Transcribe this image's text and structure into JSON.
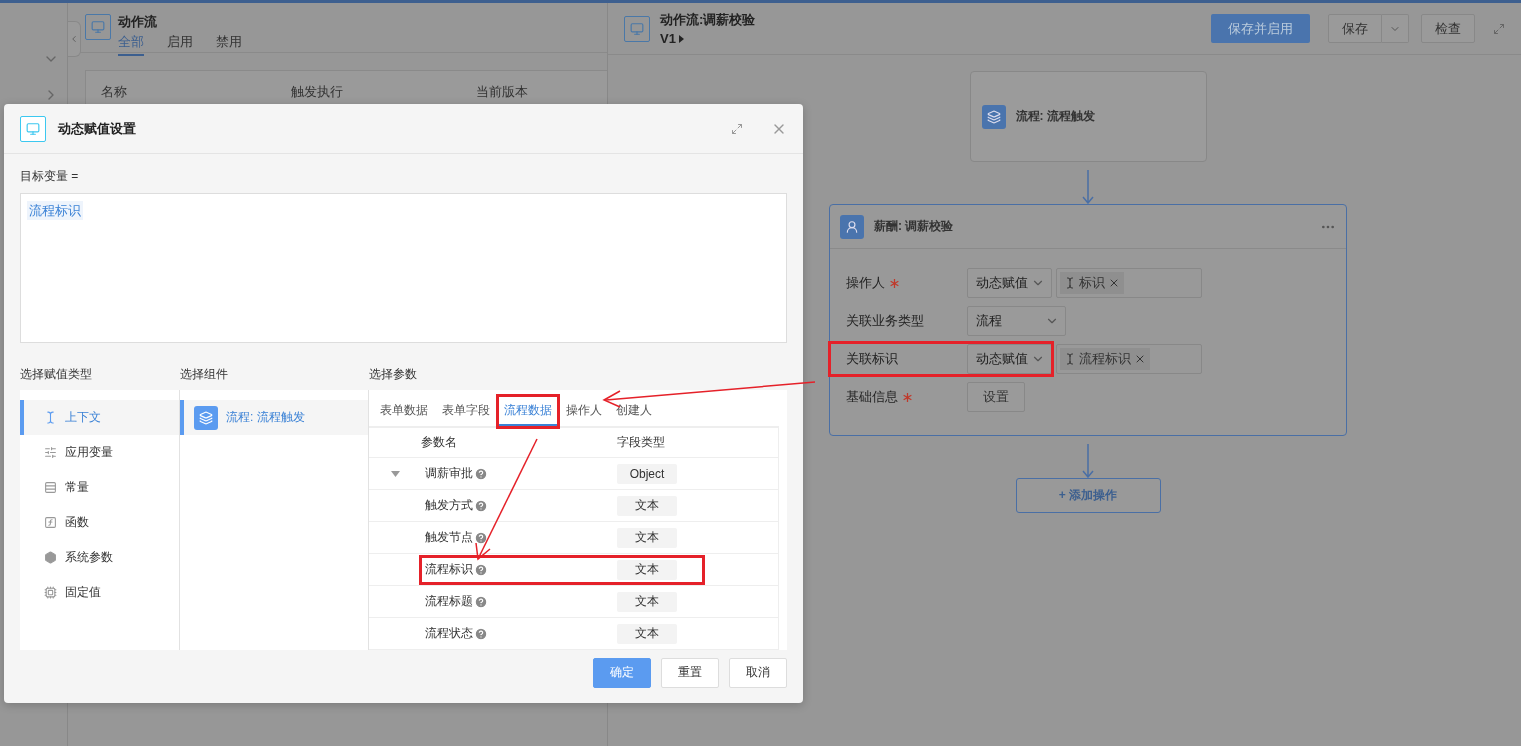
{
  "list_panel": {
    "title": "动作流",
    "tabs": [
      {
        "label": "全部",
        "selected": true
      },
      {
        "label": "启用",
        "selected": false
      },
      {
        "label": "禁用",
        "selected": false
      }
    ],
    "columns": [
      "名称",
      "触发执行",
      "当前版本"
    ]
  },
  "editor": {
    "title": "动作流:调薪校验",
    "version": "V1",
    "save_enable_button": "保存并启用",
    "save_button": "保存",
    "check_button": "检查",
    "trigger_node": {
      "title": "流程: 流程触发"
    },
    "action_node": {
      "title": "薪酬: 调薪校验",
      "fields": [
        {
          "label": "操作人",
          "required": true,
          "kind": "dynamic",
          "mode": "动态赋值",
          "tag": "标识",
          "highlighted": false
        },
        {
          "label": "关联业务类型",
          "required": false,
          "kind": "select",
          "mode": "流程",
          "highlighted": false
        },
        {
          "label": "关联标识",
          "required": false,
          "kind": "dynamic",
          "mode": "动态赋值",
          "tag": "流程标识",
          "highlighted": true
        },
        {
          "label": "基础信息",
          "required": true,
          "kind": "button",
          "button": "设置",
          "highlighted": false
        }
      ]
    },
    "add_button": "+ 添加操作"
  },
  "dialog": {
    "title": "动态赋值设置",
    "target_label": "目标变量 =",
    "target_value": "流程标识",
    "type_section": {
      "heading": "选择赋值类型",
      "items": [
        {
          "label": "上下文",
          "kind": "context",
          "selected": true
        },
        {
          "label": "应用变量",
          "kind": "variable",
          "selected": false
        },
        {
          "label": "常量",
          "kind": "constant",
          "selected": false
        },
        {
          "label": "函数",
          "kind": "function",
          "selected": false
        },
        {
          "label": "系统参数",
          "kind": "system",
          "selected": false
        },
        {
          "label": "固定值",
          "kind": "fixed",
          "selected": false
        }
      ]
    },
    "component_section": {
      "heading": "选择组件",
      "items": [
        {
          "label": "流程: 流程触发",
          "selected": true
        }
      ]
    },
    "param_section": {
      "heading": "选择参数",
      "tabs": [
        {
          "label": "表单数据",
          "selected": false,
          "highlighted": false
        },
        {
          "label": "表单字段",
          "selected": false,
          "highlighted": false
        },
        {
          "label": "流程数据",
          "selected": true,
          "highlighted": true
        },
        {
          "label": "操作人",
          "selected": false,
          "highlighted": false
        },
        {
          "label": "创建人",
          "selected": false,
          "highlighted": false
        }
      ],
      "columns": [
        "参数名",
        "字段类型"
      ],
      "rows": [
        {
          "name": "调薪审批",
          "type": "Object",
          "expandable": true,
          "expanded": true,
          "highlighted": false
        },
        {
          "name": "触发方式",
          "type": "文本",
          "expandable": false,
          "highlighted": false
        },
        {
          "name": "触发节点",
          "type": "文本",
          "expandable": false,
          "highlighted": false
        },
        {
          "name": "流程标识",
          "type": "文本",
          "expandable": false,
          "highlighted": true
        },
        {
          "name": "流程标题",
          "type": "文本",
          "expandable": false,
          "highlighted": false
        },
        {
          "name": "流程状态",
          "type": "文本",
          "expandable": false,
          "highlighted": false
        }
      ]
    },
    "buttons": [
      {
        "label": "确定",
        "primary": true
      },
      {
        "label": "重置",
        "primary": false
      },
      {
        "label": "取消",
        "primary": false
      }
    ]
  }
}
